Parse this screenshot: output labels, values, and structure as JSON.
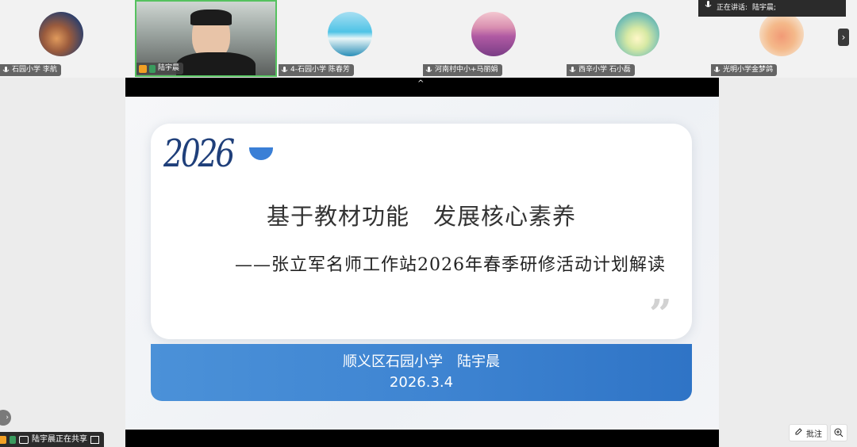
{
  "participants": [
    {
      "name": "石园小学 李航",
      "avatar": "sunset-clouds"
    },
    {
      "name": "陆宇晨",
      "avatar": "camera-video",
      "active": true
    },
    {
      "name": "4-石园小学 陈春芳",
      "avatar": "beach"
    },
    {
      "name": "河南村中小+马丽娟",
      "avatar": "lavender-field"
    },
    {
      "name": "西辛小学 石小磊",
      "avatar": "daisies"
    },
    {
      "name": "光明小学金梦鸽",
      "avatar": "cartoon-figure"
    }
  ],
  "speaking": {
    "label": "正在讲话:",
    "name": "陆宇晨;"
  },
  "slide": {
    "year_logo": "2026",
    "title": "基于教材功能　发展核心素养",
    "subtitle": "——张立军名师工作站2026年春季研修活动计划解读",
    "presenter": "顺义区石园小学　陆宇晨",
    "date": "2026.3.4"
  },
  "share_status": "陆宇晨正在共享",
  "annotate_label": "批注",
  "colors": {
    "accent_blue": "#3f85d2",
    "active_border": "#55c25f"
  }
}
